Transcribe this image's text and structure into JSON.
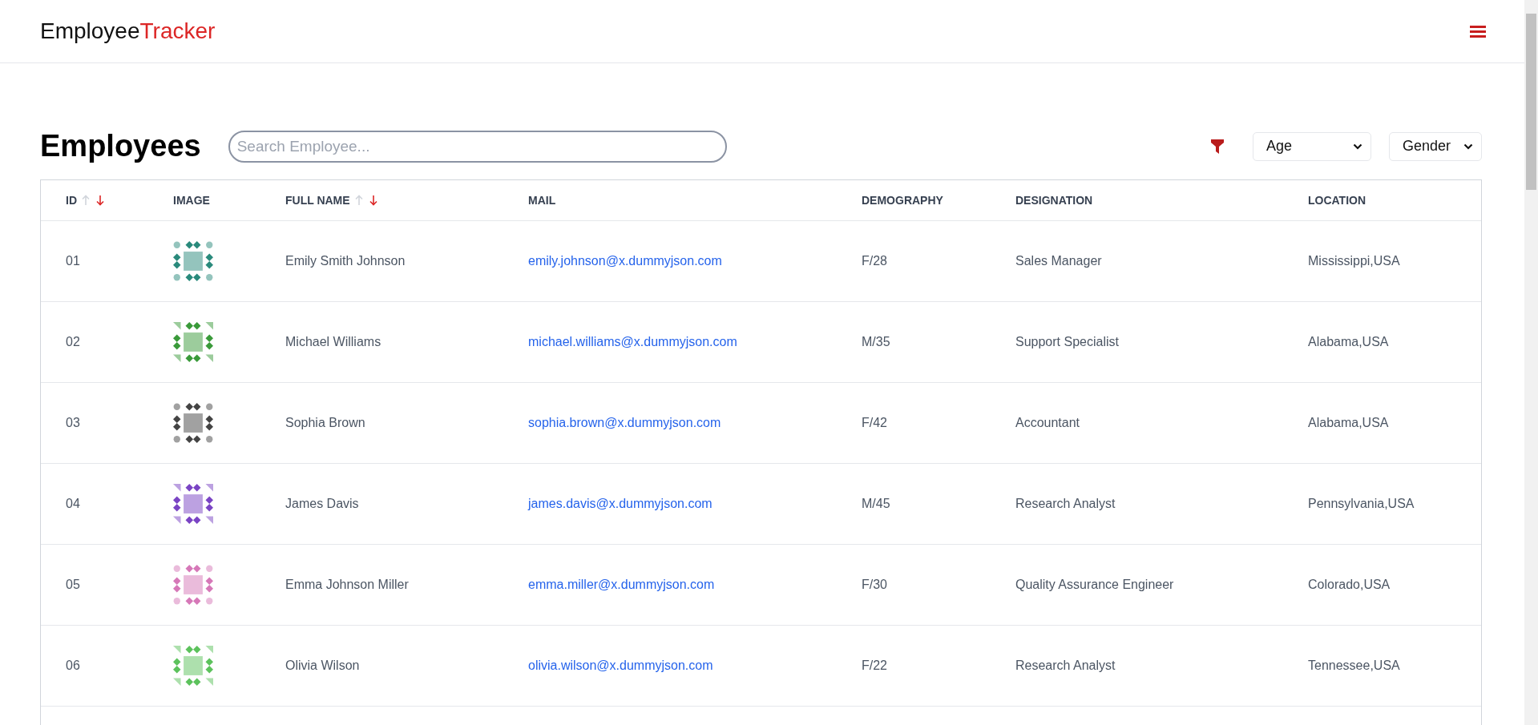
{
  "header": {
    "logo_dark": "Employee",
    "logo_accent": "Tracker"
  },
  "page": {
    "title": "Employees",
    "search": {
      "placeholder": "Search Employee..."
    },
    "filters": [
      {
        "value": "Age"
      },
      {
        "value": "Gender"
      }
    ]
  },
  "table": {
    "columns": [
      {
        "label": "ID",
        "sortable": true
      },
      {
        "label": "IMAGE",
        "sortable": false
      },
      {
        "label": "FULL NAME",
        "sortable": true
      },
      {
        "label": "MAIL",
        "sortable": false
      },
      {
        "label": "DEMOGRAPHY",
        "sortable": false
      },
      {
        "label": "DESIGNATION",
        "sortable": false
      },
      {
        "label": "LOCATION",
        "sortable": false
      }
    ],
    "rows": [
      {
        "id": "01",
        "color": "#2a8a7c",
        "name": "Emily Smith Johnson",
        "mail": "emily.johnson@x.dummyjson.com",
        "demography": "F/28",
        "designation": "Sales Manager",
        "location": "Mississippi,USA"
      },
      {
        "id": "02",
        "color": "#3a9a3a",
        "name": "Michael Williams",
        "mail": "michael.williams@x.dummyjson.com",
        "demography": "M/35",
        "designation": "Support Specialist",
        "location": "Alabama,USA"
      },
      {
        "id": "03",
        "color": "#444444",
        "name": "Sophia Brown",
        "mail": "sophia.brown@x.dummyjson.com",
        "demography": "F/42",
        "designation": "Accountant",
        "location": "Alabama,USA"
      },
      {
        "id": "04",
        "color": "#7a44c4",
        "name": "James Davis",
        "mail": "james.davis@x.dummyjson.com",
        "demography": "M/45",
        "designation": "Research Analyst",
        "location": "Pennsylvania,USA"
      },
      {
        "id": "05",
        "color": "#d678b8",
        "name": "Emma Johnson Miller",
        "mail": "emma.miller@x.dummyjson.com",
        "demography": "F/30",
        "designation": "Quality Assurance Engineer",
        "location": "Colorado,USA"
      },
      {
        "id": "06",
        "color": "#5cc25c",
        "name": "Olivia Wilson",
        "mail": "olivia.wilson@x.dummyjson.com",
        "demography": "F/22",
        "designation": "Research Analyst",
        "location": "Tennessee,USA"
      }
    ]
  }
}
